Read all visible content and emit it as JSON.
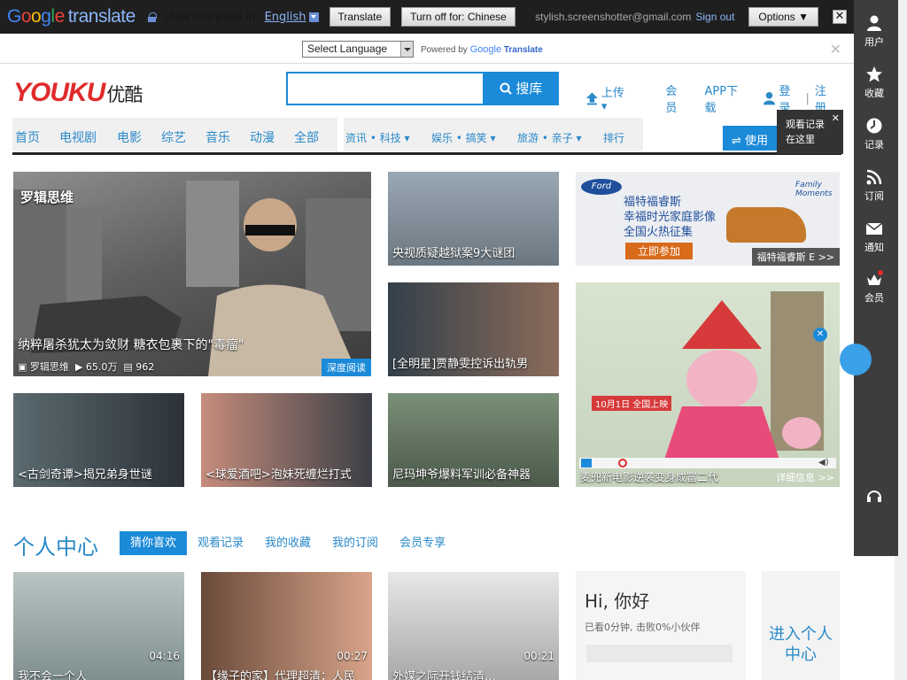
{
  "google_translate": {
    "logo_word": "Google",
    "logo_product": "translate",
    "view_text": "View this page in:",
    "language": "English",
    "translate_button": "Translate",
    "turn_off_button": "Turn off for: Chinese",
    "email": "stylish.screenshotter@gmail.com",
    "sign_out": "Sign out",
    "options": "Options ▼",
    "close": "✕"
  },
  "language_bar": {
    "select_placeholder": "Select Language",
    "powered_by": "Powered by",
    "google": "Google",
    "translate": "Translate",
    "close": "✕"
  },
  "header": {
    "logo": "YOUKU",
    "logo_cn": "优酷",
    "search_button": "搜库",
    "upload": "上传",
    "vip": "会员",
    "app_download": "APP下载",
    "login": "登录",
    "register": "注册",
    "divider": "|"
  },
  "nav": {
    "main": [
      "首页",
      "电视剧",
      "电影",
      "综艺",
      "音乐",
      "动漫",
      "全部"
    ],
    "sub": [
      "资讯 • 科技",
      "娱乐 • 搞笑",
      "旅游 • 亲子",
      "排行"
    ],
    "use_label": "使用"
  },
  "watch_tooltip": {
    "line1": "观看记录",
    "line2": "在这里",
    "close": "✕"
  },
  "right_rail": [
    {
      "label": "用户",
      "icon": "user-icon"
    },
    {
      "label": "收藏",
      "icon": "star-icon"
    },
    {
      "label": "记录",
      "icon": "clock-icon"
    },
    {
      "label": "订阅",
      "icon": "rss-icon"
    },
    {
      "label": "通知",
      "icon": "mail-icon"
    },
    {
      "label": "会员",
      "icon": "crown-icon"
    }
  ],
  "featured": {
    "logo_text": "罗辑思维",
    "caption": "纳粹屠杀犹太为敛财 糖衣包裹下的\"毒瘤\"",
    "author": "罗辑思维",
    "views": "65.0万",
    "comments": "962",
    "badge": "深度阅读"
  },
  "tiles": [
    {
      "caption": "央视质疑越狱案9大谜团"
    },
    {
      "caption": "[全明星]贾静雯控诉出轨男"
    },
    {
      "caption": "<古剑奇谭>揭兄弟身世谜"
    },
    {
      "caption": "<球爱酒吧>泡妹死缠烂打式"
    },
    {
      "caption": "尼玛坤爷爆料军训必备神器"
    }
  ],
  "ad": {
    "brand": "Ford",
    "tagline": "Family Moments",
    "line1": "福特福睿斯",
    "line2": "幸福时光家庭影像",
    "line3": "全国火热征集",
    "button": "立即参加",
    "footer": "福特福睿斯 E",
    "arrows": ">>"
  },
  "cartoon": {
    "caption": "麦兜新电影逆袭变身成富二代",
    "detail": "详细信息 >>",
    "date": "10月1日 全国上映"
  },
  "personal": {
    "title": "个人中心",
    "tabs": [
      "猜你喜欢",
      "观看记录",
      "我的收藏",
      "我的订阅",
      "会员专享"
    ]
  },
  "durations": [
    "04:16",
    "00:27",
    "00:21"
  ],
  "bottom_captions": [
    "我不会一个人",
    "【缘子的家】代理超清：人民",
    "外媒之际开钱结清…"
  ],
  "hi_card": {
    "title": "Hi, 你好",
    "subtitle": "已看0分钟, 击败0%小伙伴",
    "enter": "进入个人中心"
  }
}
